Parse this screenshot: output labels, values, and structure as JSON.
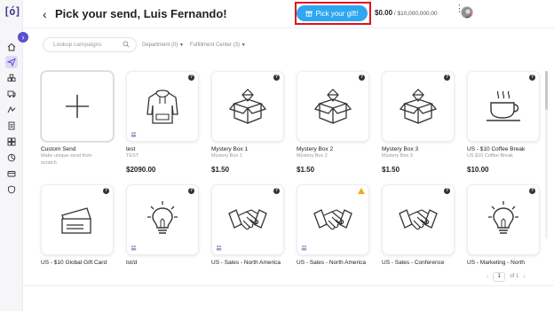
{
  "brand": {
    "logo_text": "[ó]",
    "accent": "#5a4fcf"
  },
  "rail": {
    "toggle_glyph": "›",
    "icons": [
      "home-icon",
      "send-icon",
      "inventory-icon",
      "orders-icon",
      "campaigns-icon",
      "reports-icon",
      "integrations-icon",
      "analytics-icon",
      "billing-icon",
      "security-icon"
    ]
  },
  "header": {
    "back_glyph": "‹",
    "title": "Pick your send, Luis Fernando!",
    "pick_gift_label": "Pick your gift!",
    "balance_amount": "$0.00",
    "balance_separator": " / ",
    "balance_limit": "$10,000,000.00"
  },
  "filters": {
    "search_placeholder": "Lookup campaigns",
    "department_label": "Department (0)",
    "fulfillment_label": "Fulfillment Center (3)"
  },
  "cards": [
    {
      "name": "Custom Send",
      "sub": "Make unique send from",
      "sub2": "scratch",
      "price": "",
      "icon": "plus-icon"
    },
    {
      "name": "test",
      "sub": "TEST",
      "sub2": "",
      "price": "$2090.00",
      "icon": "hoodie-icon"
    },
    {
      "name": "Mystery Box 1",
      "sub": "Mystery Box 1",
      "sub2": "",
      "price": "$1.50",
      "icon": "mystery-box-icon"
    },
    {
      "name": "Mystery Box 2",
      "sub": "Mystery Box 2",
      "sub2": "",
      "price": "$1.50",
      "icon": "mystery-box-icon"
    },
    {
      "name": "Mystery Box 3",
      "sub": "Mystery Box 3",
      "sub2": "",
      "price": "$1.50",
      "icon": "mystery-box-icon"
    },
    {
      "name": "US - $10 Coffee Break",
      "sub": "US $10 Coffee Break",
      "sub2": "",
      "price": "$10.00",
      "icon": "coffee-cup-icon"
    },
    {
      "name": "US - $10 Global Gift Card",
      "sub": "",
      "sub2": "",
      "price": "",
      "icon": "gift-card-icon"
    },
    {
      "name": "tst/d",
      "sub": "",
      "sub2": "",
      "price": "",
      "icon": "lightbulb-icon"
    },
    {
      "name": "US - Sales - North America",
      "sub": "",
      "sub2": "",
      "price": "",
      "icon": "handshake-icon"
    },
    {
      "name": "US - Sales - North America",
      "sub": "",
      "sub2": "",
      "price": "",
      "icon": "handshake-icon"
    },
    {
      "name": "US - Sales - Conference",
      "sub": "",
      "sub2": "",
      "price": "",
      "icon": "handshake-icon"
    },
    {
      "name": "US - Marketing - North",
      "sub": "",
      "sub2": "",
      "price": "",
      "icon": "lightbulb-icon"
    }
  ],
  "pagination": {
    "current": "1",
    "of_label": "of 1",
    "prev": "‹",
    "next": "›"
  }
}
